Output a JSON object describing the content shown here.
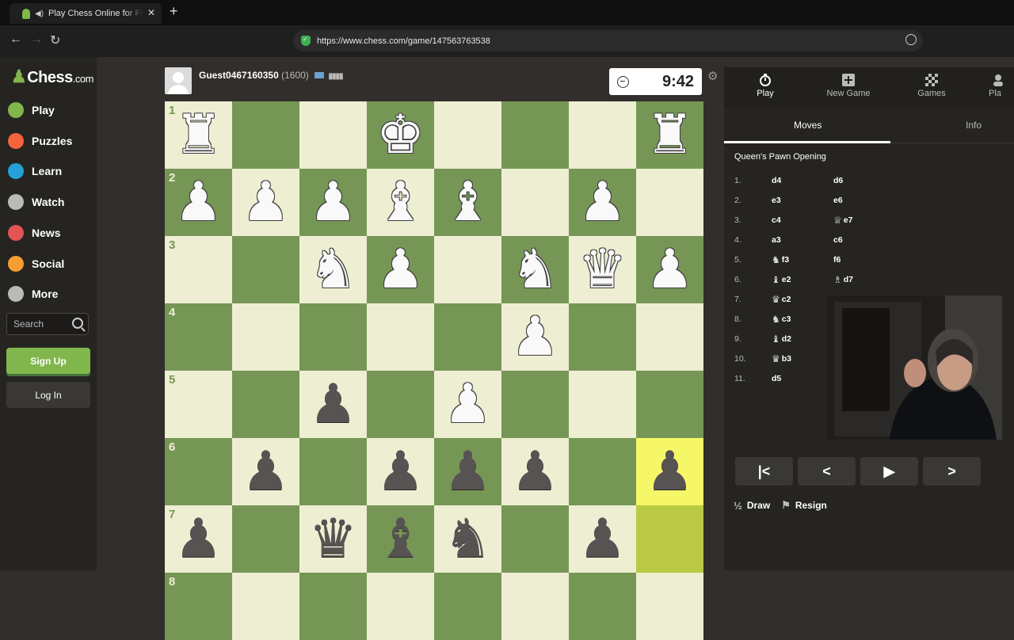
{
  "browser": {
    "tab_title": "Play Chess Online for FREE",
    "url": "https://www.chess.com/game/147563763538"
  },
  "sidebar": {
    "logo_main": "Chess",
    "logo_suffix": ".com",
    "items": [
      {
        "label": "Play",
        "icon": "play-pawn-icon",
        "color": "#81b64c"
      },
      {
        "label": "Puzzles",
        "icon": "puzzle-icon",
        "color": "#f4643d"
      },
      {
        "label": "Learn",
        "icon": "learn-icon",
        "color": "#26a0d8"
      },
      {
        "label": "Watch",
        "icon": "binoculars-icon",
        "color": "#bababa"
      },
      {
        "label": "News",
        "icon": "newspaper-icon",
        "color": "#e15554"
      },
      {
        "label": "Social",
        "icon": "social-icon",
        "color": "#f59e32"
      },
      {
        "label": "More",
        "icon": "more-dots-icon",
        "color": "#bababa"
      }
    ],
    "search_placeholder": "Search",
    "signup_label": "Sign Up",
    "login_label": "Log In"
  },
  "player": {
    "name": "Guest0467160350",
    "rating": "(1600)",
    "clock": "9:42"
  },
  "board": {
    "ranks": [
      "1",
      "2",
      "3",
      "4",
      "5",
      "6",
      "7",
      "8"
    ],
    "rows": [
      [
        "wR",
        "",
        "",
        "wK",
        "",
        "",
        "",
        "wR"
      ],
      [
        "wP",
        "wP",
        "wP",
        "wB",
        "wB",
        "",
        "wP",
        ""
      ],
      [
        "",
        "",
        "wN",
        "wP",
        "",
        "wN",
        "wQ",
        "wP"
      ],
      [
        "",
        "",
        "",
        "",
        "",
        "wP",
        "",
        ""
      ],
      [
        "",
        "",
        "bP",
        "",
        "wP",
        "",
        "",
        ""
      ],
      [
        "",
        "bP",
        "",
        "bP",
        "bP",
        "bP",
        "",
        "bP"
      ],
      [
        "bP",
        "",
        "bQ",
        "bB",
        "bN",
        "",
        "bP",
        ""
      ],
      [
        "",
        "",
        "",
        "",
        "",
        "",
        "",
        ""
      ]
    ],
    "highlights": [
      [
        5,
        7
      ],
      [
        6,
        7
      ]
    ]
  },
  "panel": {
    "tabs": [
      {
        "label": "Play",
        "icon": "stopwatch-icon"
      },
      {
        "label": "New Game",
        "icon": "plus-icon"
      },
      {
        "label": "Games",
        "icon": "board-icon"
      },
      {
        "label": "Pla",
        "icon": "players-icon"
      }
    ],
    "subtabs": [
      "Moves",
      "Info"
    ],
    "opening": "Queen's Pawn Opening",
    "moves": [
      {
        "n": "1.",
        "w": "d4",
        "wf": "",
        "b": "d6",
        "bf": ""
      },
      {
        "n": "2.",
        "w": "e3",
        "wf": "",
        "b": "e6",
        "bf": ""
      },
      {
        "n": "3.",
        "w": "c4",
        "wf": "",
        "b": "e7",
        "bf": "♕"
      },
      {
        "n": "4.",
        "w": "a3",
        "wf": "",
        "b": "c6",
        "bf": ""
      },
      {
        "n": "5.",
        "w": "f3",
        "wf": "♞",
        "b": "f6",
        "bf": ""
      },
      {
        "n": "6.",
        "w": "e2",
        "wf": "♝",
        "b": "d7",
        "bf": "♗"
      },
      {
        "n": "7.",
        "w": "c2",
        "wf": "♛",
        "b": "",
        "bf": ""
      },
      {
        "n": "8.",
        "w": "c3",
        "wf": "♞",
        "b": "",
        "bf": ""
      },
      {
        "n": "9.",
        "w": "d2",
        "wf": "♝",
        "b": "",
        "bf": ""
      },
      {
        "n": "10.",
        "w": "b3",
        "wf": "♛",
        "b": "",
        "bf": ""
      },
      {
        "n": "11.",
        "w": "d5",
        "wf": "",
        "b": "",
        "bf": ""
      }
    ],
    "controls": [
      "first-move-icon",
      "prev-move-icon",
      "play-icon",
      "next-move-icon"
    ],
    "draw_label": "Draw",
    "resign_label": "Resign"
  }
}
